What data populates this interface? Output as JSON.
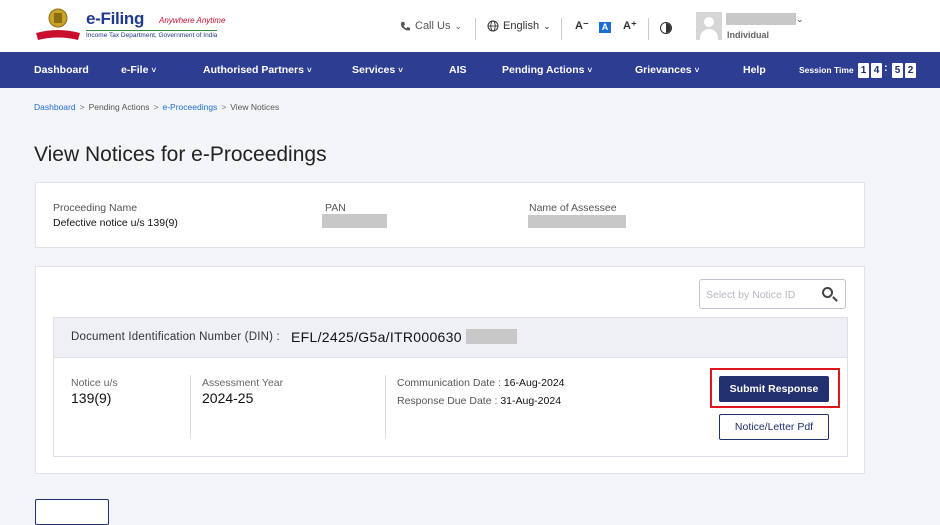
{
  "header": {
    "logo_title": "e-Filing",
    "logo_tagline": "Anywhere Anytime",
    "logo_subtitle": "Income Tax Department, Government of India",
    "call_us": "Call Us",
    "language": "English",
    "font_decrease": "A⁻",
    "font_default": "A",
    "font_increase": "A⁺",
    "user_type": "Individual"
  },
  "nav": {
    "items": [
      {
        "label": "Dashboard"
      },
      {
        "label": "e-File",
        "chevron": "˅"
      },
      {
        "label": "Authorised Partners",
        "chevron": "˅"
      },
      {
        "label": "Services",
        "chevron": "˅"
      },
      {
        "label": "AIS"
      },
      {
        "label": "Pending Actions",
        "chevron": "˅"
      },
      {
        "label": "Grievances",
        "chevron": "˅"
      },
      {
        "label": "Help"
      }
    ],
    "session_label": "Session Time",
    "session_digits": [
      "1",
      "4",
      "5",
      "2"
    ]
  },
  "breadcrumb": {
    "items": [
      "Dashboard",
      "Pending Actions",
      "e-Proceedings",
      "View Notices"
    ],
    "separator": ">"
  },
  "page_title": "View Notices for e-Proceedings",
  "info": {
    "proceeding_label": "Proceeding Name",
    "proceeding_value": "Defective notice u/s 139(9)",
    "pan_label": "PAN",
    "assessee_label": "Name of Assessee"
  },
  "search": {
    "placeholder": "Select by Notice ID"
  },
  "notice": {
    "din_label": "Document Identification Number (DIN) :",
    "din_value": "EFL/2425/G5a/ITR000630",
    "notice_us_label": "Notice u/s",
    "notice_us_value": "139(9)",
    "ay_label": "Assessment Year",
    "ay_value": "2024-25",
    "comm_date_label": "Communication Date :",
    "comm_date_value": "16-Aug-2024",
    "due_date_label": "Response Due Date :",
    "due_date_value": "31-Aug-2024",
    "submit_label": "Submit Response",
    "pdf_label": "Notice/Letter Pdf"
  },
  "colors": {
    "nav_bg": "#2d3d92",
    "primary_button": "#22306f",
    "highlight": "#e0161e",
    "link": "#1f6fd1"
  },
  "icons": [
    "emblem-icon",
    "phone-icon",
    "globe-icon",
    "contrast-icon",
    "avatar-icon",
    "search-icon"
  ]
}
